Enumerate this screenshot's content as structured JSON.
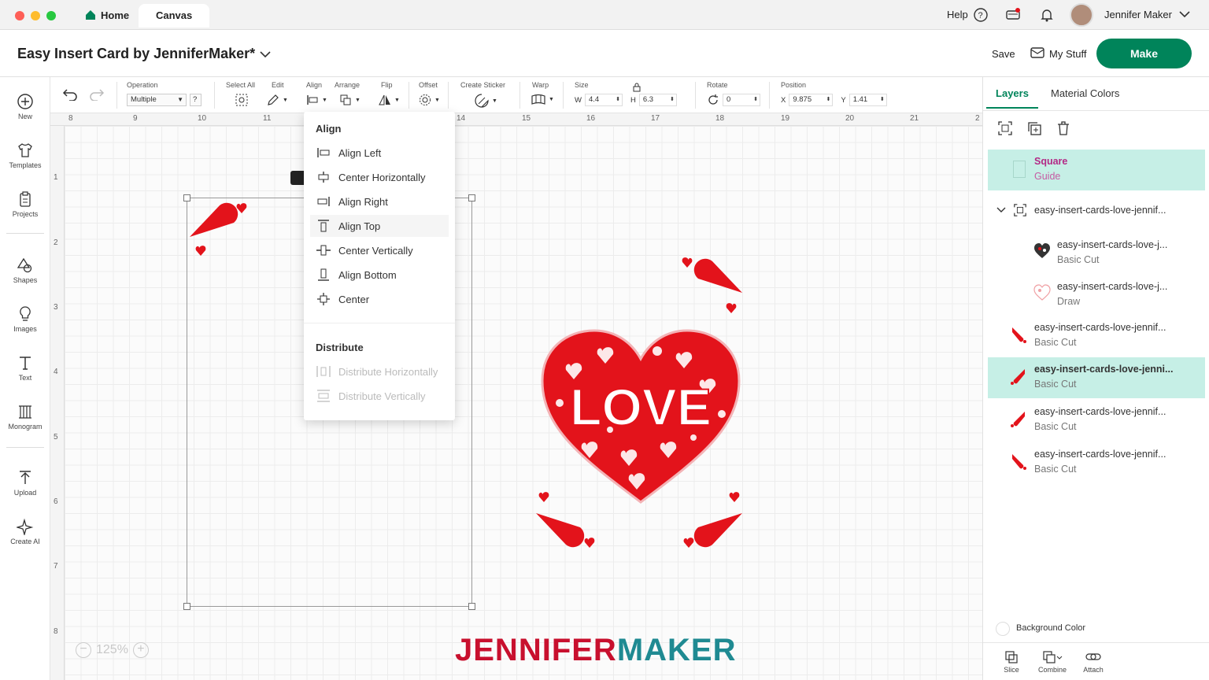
{
  "tabs": {
    "home": "Home",
    "canvas": "Canvas"
  },
  "top_right": {
    "help": "Help",
    "user_name": "Jennifer Maker"
  },
  "project": {
    "title": "Easy Insert Card by JenniferMaker*",
    "save": "Save",
    "my_stuff": "My Stuff",
    "make": "Make"
  },
  "nav": [
    {
      "label": "New",
      "icon": "plus-circle-icon"
    },
    {
      "label": "Templates",
      "icon": "shirt-icon"
    },
    {
      "label": "Projects",
      "icon": "clipboard-icon"
    },
    {
      "label": "Shapes",
      "icon": "shapes-icon"
    },
    {
      "label": "Images",
      "icon": "lightbulb-icon"
    },
    {
      "label": "Text",
      "icon": "text-icon"
    },
    {
      "label": "Monogram",
      "icon": "monogram-icon"
    },
    {
      "label": "Upload",
      "icon": "upload-icon"
    },
    {
      "label": "Create AI",
      "icon": "sparkle-icon"
    }
  ],
  "toolbar": {
    "operation_label": "Operation",
    "operation_value": "Multiple",
    "operation_help": "?",
    "select_all": "Select All",
    "edit": "Edit",
    "align": "Align",
    "arrange": "Arrange",
    "flip": "Flip",
    "offset": "Offset",
    "create_sticker": "Create Sticker",
    "warp": "Warp",
    "size": "Size",
    "w_label": "W",
    "w_value": "4.4",
    "h_label": "H",
    "h_value": "6.3",
    "rotate": "Rotate",
    "rotate_value": "0",
    "position": "Position",
    "x_label": "X",
    "x_value": "9.875",
    "y_label": "Y",
    "y_value": "1.41"
  },
  "ruler": {
    "h": [
      "8",
      "9",
      "10",
      "11",
      "12",
      "13",
      "14",
      "15",
      "16",
      "17",
      "18",
      "19",
      "20",
      "21",
      "2"
    ],
    "v": [
      "1",
      "2",
      "3",
      "4",
      "5",
      "6",
      "7",
      "8"
    ]
  },
  "align_menu": {
    "title": "Align",
    "items": [
      "Align Left",
      "Center Horizontally",
      "Align Right",
      "Align Top",
      "Center Vertically",
      "Align Bottom",
      "Center"
    ],
    "distribute_title": "Distribute",
    "distribute_items": [
      "Distribute Horizontally",
      "Distribute Vertically"
    ]
  },
  "panel": {
    "tabs": [
      "Layers",
      "Material Colors"
    ],
    "layers": [
      {
        "name": "Square",
        "type": "Guide"
      },
      {
        "name": "easy-insert-cards-love-jennif...",
        "type": ""
      },
      {
        "name": "easy-insert-cards-love-j...",
        "type": "Basic Cut"
      },
      {
        "name": "easy-insert-cards-love-j...",
        "type": "Draw"
      },
      {
        "name": "easy-insert-cards-love-jennif...",
        "type": "Basic Cut"
      },
      {
        "name": "easy-insert-cards-love-jenni...",
        "type": "Basic Cut"
      },
      {
        "name": "easy-insert-cards-love-jennif...",
        "type": "Basic Cut"
      },
      {
        "name": "easy-insert-cards-love-jennif...",
        "type": "Basic Cut"
      }
    ],
    "background_color": "Background Color",
    "bottom_tools": [
      "Slice",
      "Combine",
      "Attach"
    ]
  },
  "zoom": "125%",
  "watermark": {
    "part1": "JENNIFER",
    "part2": "MAKER"
  },
  "heart_word": "LOVE",
  "colors": {
    "accent": "#00845a",
    "red": "#e3131b",
    "teal": "#c6efe6"
  }
}
